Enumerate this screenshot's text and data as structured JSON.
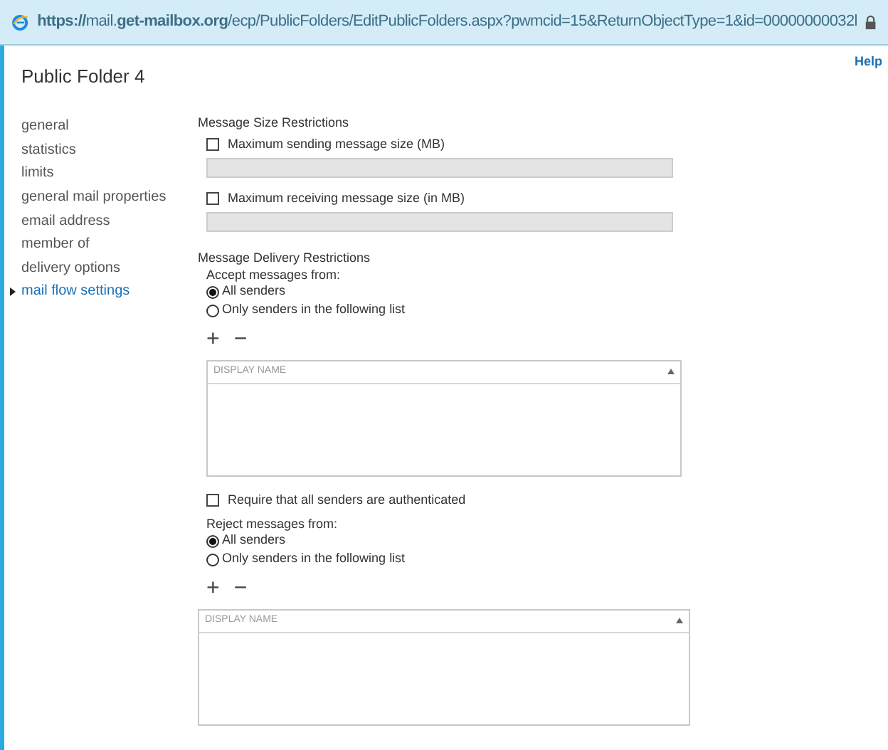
{
  "address_bar": {
    "url": "**https://**mail.**get-mailbox.org**/ecp/PublicFolders/EditPublicFolders.aspx?pwmcid=15&ReturnObjectType=1&id=00000000032l"
  },
  "title": "Public Folder 4",
  "help": "Help",
  "sidebar": {
    "items": [
      {
        "label": "general",
        "selected": false
      },
      {
        "label": "statistics",
        "selected": false
      },
      {
        "label": "limits",
        "selected": false
      },
      {
        "label": "general mail properties",
        "selected": false
      },
      {
        "label": "email address",
        "selected": false
      },
      {
        "label": "member of",
        "selected": false
      },
      {
        "label": "delivery options",
        "selected": false
      },
      {
        "label": "mail flow settings",
        "selected": true
      }
    ]
  },
  "size_restrictions": {
    "heading": "Message Size Restrictions",
    "fields": [
      {
        "label": "Maximum sending message size (MB)",
        "checked": false,
        "disabled": true
      },
      {
        "label": "Maximum receiving message size (in MB)",
        "checked": false,
        "disabled": true
      }
    ]
  },
  "delivery_restrictions": {
    "heading": "Message Delivery Restrictions",
    "accept": {
      "label": "Accept messages from:",
      "options": [
        {
          "label": "All senders",
          "selected": true
        },
        {
          "label": "Only senders in the following list",
          "selected": false
        }
      ],
      "add": "+",
      "remove": "−",
      "table": {
        "columns": [
          "DISPLAY NAME"
        ]
      }
    },
    "require_auth": {
      "label": "Require that all senders are authenticated",
      "checked": false
    },
    "reject": {
      "label": "Reject messages from:",
      "options": [
        {
          "label": "All senders",
          "selected": true
        },
        {
          "label": "Only senders in the following list",
          "selected": false
        }
      ],
      "add": "+",
      "remove": "−",
      "table": {
        "columns": [
          "DISPLAY NAME"
        ]
      }
    }
  }
}
